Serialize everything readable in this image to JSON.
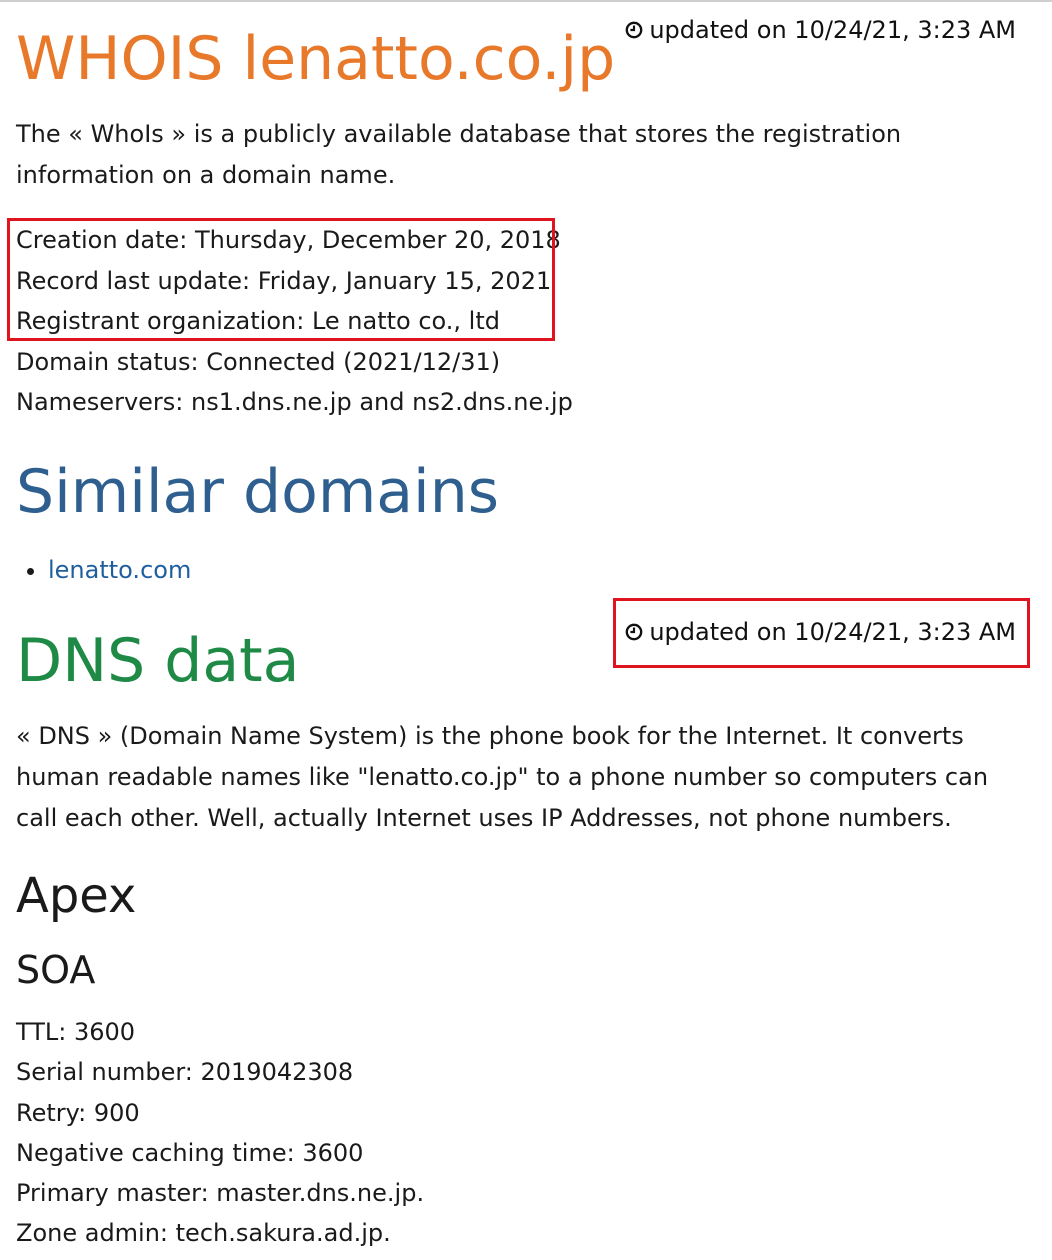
{
  "whois": {
    "title": "WHOIS lenatto.co.jp",
    "updated": "updated on 10/24/21, 3:23 AM",
    "intro": "The « WhoIs » is a publicly available database that stores the registration information on a domain name.",
    "fields": [
      "Creation date: Thursday, December 20, 2018",
      "Record last update: Friday, January 15, 2021",
      "Registrant organization: Le natto co., ltd",
      "Domain status: Connected (2021/12/31)",
      "Nameservers: ns1.dns.ne.jp and ns2.dns.ne.jp"
    ]
  },
  "similar": {
    "title": "Similar domains",
    "items": [
      "lenatto.com"
    ]
  },
  "dns": {
    "title": "DNS data",
    "updated": "updated on 10/24/21, 3:23 AM",
    "intro": "« DNS » (Domain Name System) is the phone book for the Internet. It converts human readable names like \"lenatto.co.jp\" to a phone number so computers can call each other. Well, actually Internet uses IP Addresses, not phone numbers.",
    "apex_title": "Apex",
    "soa_title": "SOA",
    "soa": [
      "TTL: 3600",
      "Serial number: 2019042308",
      "Retry: 900",
      "Negative caching time: 3600",
      "Primary master: master.dns.ne.jp.",
      "Zone admin: tech.sakura.ad.jp."
    ]
  },
  "colors": {
    "whois_title": "#e8792a",
    "similar_title": "#2f5f8f",
    "dns_title": "#1e8a45",
    "highlight": "#e0141e",
    "link": "#1f5f9f"
  },
  "icons": {
    "updated": "clock-icon"
  }
}
